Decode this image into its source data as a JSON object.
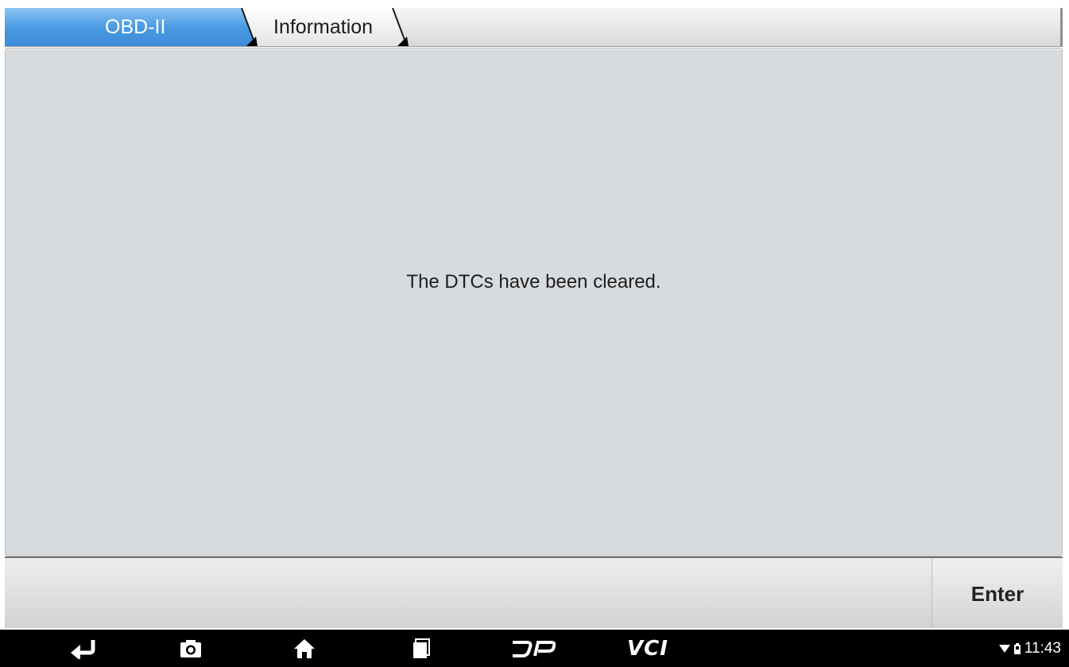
{
  "breadcrumb": {
    "items": [
      {
        "label": "OBD-II",
        "active": true
      },
      {
        "label": "Information",
        "active": false
      }
    ]
  },
  "content": {
    "message": "The DTCs have been cleared."
  },
  "actions": {
    "enter_label": "Enter"
  },
  "navbar": {
    "icons": [
      "back-icon",
      "screenshot-icon",
      "home-icon",
      "recent-apps-icon",
      "dp-icon"
    ],
    "vci_label": "VCI"
  },
  "status": {
    "time": "11:43"
  },
  "colors": {
    "active_tab": "#4a9be3",
    "content_bg": "#d8dbde",
    "navbar_bg": "#000000"
  }
}
